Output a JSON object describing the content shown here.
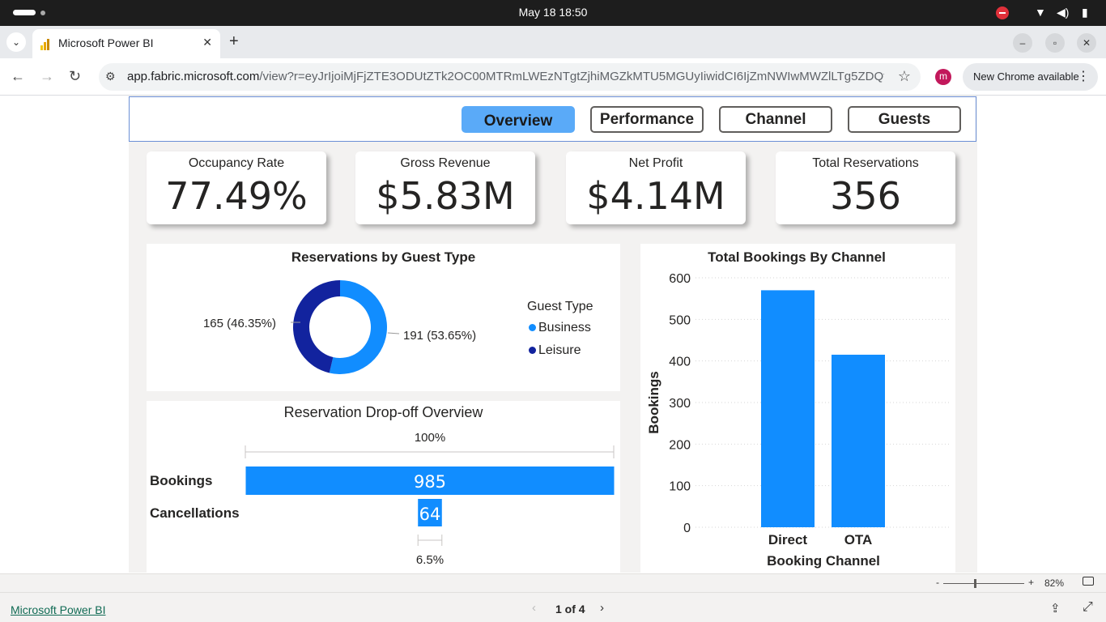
{
  "os": {
    "clock": "May 18  18:50"
  },
  "browser": {
    "tab_title": "Microsoft Power BI",
    "new_tab_icon": "+",
    "url_host": "app.fabric.microsoft.com",
    "url_path": "/view?r=eyJrIjoiMjFjZTE3ODUtZTk2OC00MTRmLWEzNTgtZjhiMGZkMTU5MGUyIiwidCI6IjZmNWIwMWZlLTg5ZDQtNDk4Ny...",
    "profile_initial": "m",
    "chrome_notice": "New Chrome available"
  },
  "report": {
    "nav": {
      "overview": "Overview",
      "performance": "Performance",
      "channel": "Channel",
      "guests": "Guests",
      "active": "Overview"
    },
    "kpis": [
      {
        "label": "Occupancy Rate",
        "value": "77.49%"
      },
      {
        "label": "Gross Revenue",
        "value": "$5.83M"
      },
      {
        "label": "Net Profit",
        "value": "$4.14M"
      },
      {
        "label": "Total Reservations",
        "value": "356"
      }
    ],
    "donut": {
      "title": "Reservations by Guest Type",
      "legend_title": "Guest Type",
      "slices": [
        {
          "name": "Business",
          "value": 191,
          "label": "191 (53.65%)",
          "color": "#118dff"
        },
        {
          "name": "Leisure",
          "value": 165,
          "label": "165 (46.35%)",
          "color": "#12239e"
        }
      ]
    },
    "funnel": {
      "title": "Reservation Drop-off Overview",
      "top_pct": "100%",
      "bottom_pct": "6.5%",
      "rows": [
        {
          "name": "Bookings",
          "value": 985,
          "label": "985"
        },
        {
          "name": "Cancellations",
          "value": 64,
          "label": "64"
        }
      ],
      "color": "#118dff"
    },
    "bar": {
      "title": "Total Bookings By Channel",
      "xlabel": "Booking Channel",
      "ylabel": "Bookings",
      "color": "#118dff"
    }
  },
  "chart_data": {
    "type": "bar",
    "title": "Total Bookings By Channel",
    "categories": [
      "Direct",
      "OTA"
    ],
    "values": [
      570,
      415
    ],
    "xlabel": "Booking Channel",
    "ylabel": "Bookings",
    "ylim": [
      0,
      600
    ],
    "yticks": [
      "0",
      "100",
      "200",
      "300",
      "400",
      "500",
      "600"
    ],
    "grid": true
  },
  "footer": {
    "app_link": "Microsoft Power BI",
    "page_indicator": "1 of 4",
    "zoom": "82%"
  }
}
